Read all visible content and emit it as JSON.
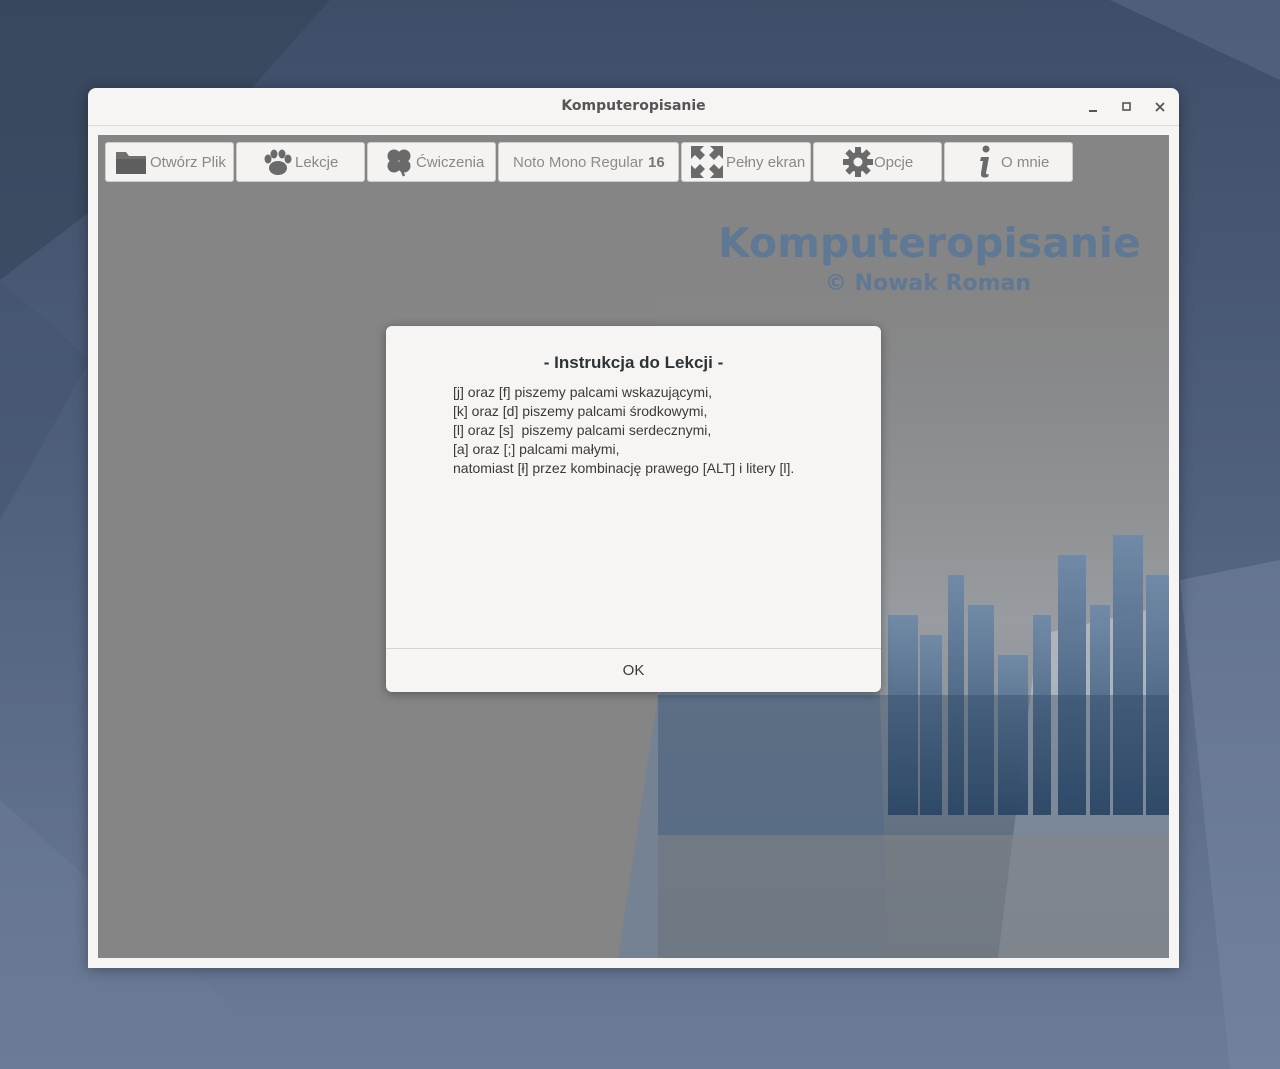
{
  "window": {
    "title": "Komputeropisanie",
    "controls": {
      "minimize_icon": "minimize-icon",
      "maximize_icon": "maximize-icon",
      "close_icon": "close-icon"
    }
  },
  "toolbar": {
    "open_file": "Otwórz Plik",
    "lessons": "Lekcje",
    "exercises": "Ćwiczenia",
    "font_name": "Noto Mono Regular",
    "font_size": "16",
    "fullscreen": "Pełny ekran",
    "options": "Opcje",
    "about": "O mnie"
  },
  "branding": {
    "title": "Komputeropisanie",
    "subtitle": "© Nowak Roman"
  },
  "dialog": {
    "title": "- Instrukcja do Lekcji -",
    "lines": [
      "[j] oraz [f] piszemy palcami wskazującymi,",
      "[k] oraz [d] piszemy palcami środkowymi,",
      "[l] oraz [s]  piszemy palcami serdecznymi,",
      "[a] oraz [;] palcami małymi,",
      "natomiast [ł] przez kombinację prawego [ALT] i litery [l]."
    ],
    "ok_label": "OK"
  },
  "colors": {
    "accent_text": "#5f7893",
    "content_bg": "#858585",
    "dialog_bg": "#f6f5f4"
  }
}
